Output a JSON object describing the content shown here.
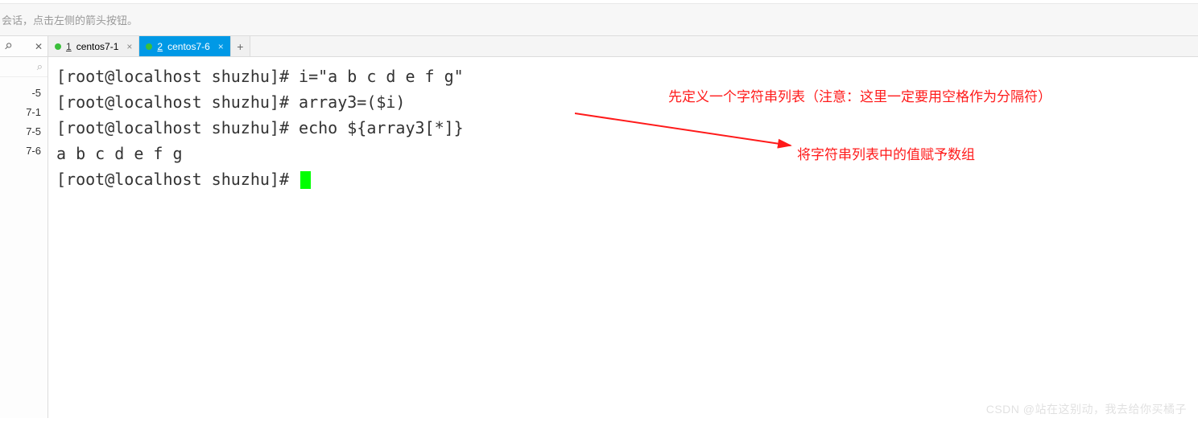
{
  "top": {
    "faded": " "
  },
  "hint": "会话，点击左侧的箭头按钮。",
  "left_icons": {
    "pin": "📌",
    "close": "✕",
    "search": "🔍"
  },
  "side_items": [
    "-5",
    "7-1",
    "7-5",
    "7-6"
  ],
  "tabs": [
    {
      "num": "1",
      "label": "centos7-1",
      "active": false
    },
    {
      "num": "2",
      "label": "centos7-6",
      "active": true
    }
  ],
  "tab_add": "+",
  "terminal_lines": [
    "[root@localhost shuzhu]# i=\"a b c d e f g\"",
    "[root@localhost shuzhu]# array3=($i)",
    "[root@localhost shuzhu]# echo ${array3[*]}",
    "a b c d e f g",
    "[root@localhost shuzhu]# "
  ],
  "annotations": {
    "line1": "先定义一个字符串列表（注意：这里一定要用空格作为分隔符）",
    "line2": "将字符串列表中的值赋予数组"
  },
  "watermark": "CSDN @站在这别动，我去给你买橘子"
}
